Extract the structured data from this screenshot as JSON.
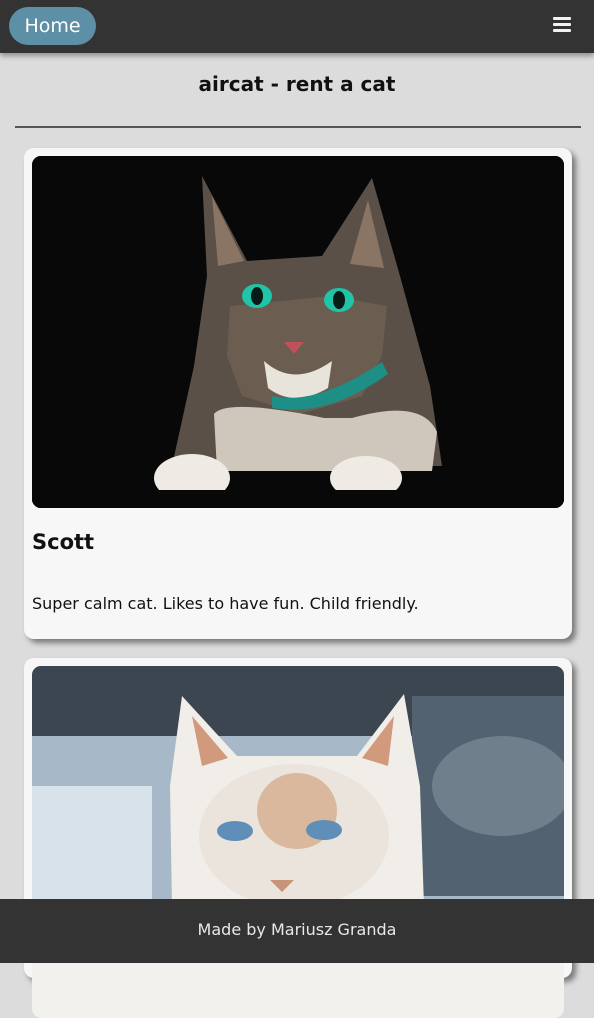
{
  "nav": {
    "home_label": "Home",
    "menu_icon": "hamburger-menu-icon"
  },
  "header": {
    "title": "aircat - rent a cat"
  },
  "cats": [
    {
      "name": "Scott",
      "description": "Super calm cat. Likes to have fun. Child friendly.",
      "photo": "tabby cat with green eyes on black background"
    },
    {
      "name": "",
      "description": "",
      "photo": "white cat with blue eyes"
    }
  ],
  "footer": {
    "text": "Made by Mariusz Granda"
  },
  "colors": {
    "bar": "#333333",
    "home_button": "#5d8fa6",
    "page_bg": "#dcdcdc",
    "card_bg": "#f7f7f7"
  }
}
